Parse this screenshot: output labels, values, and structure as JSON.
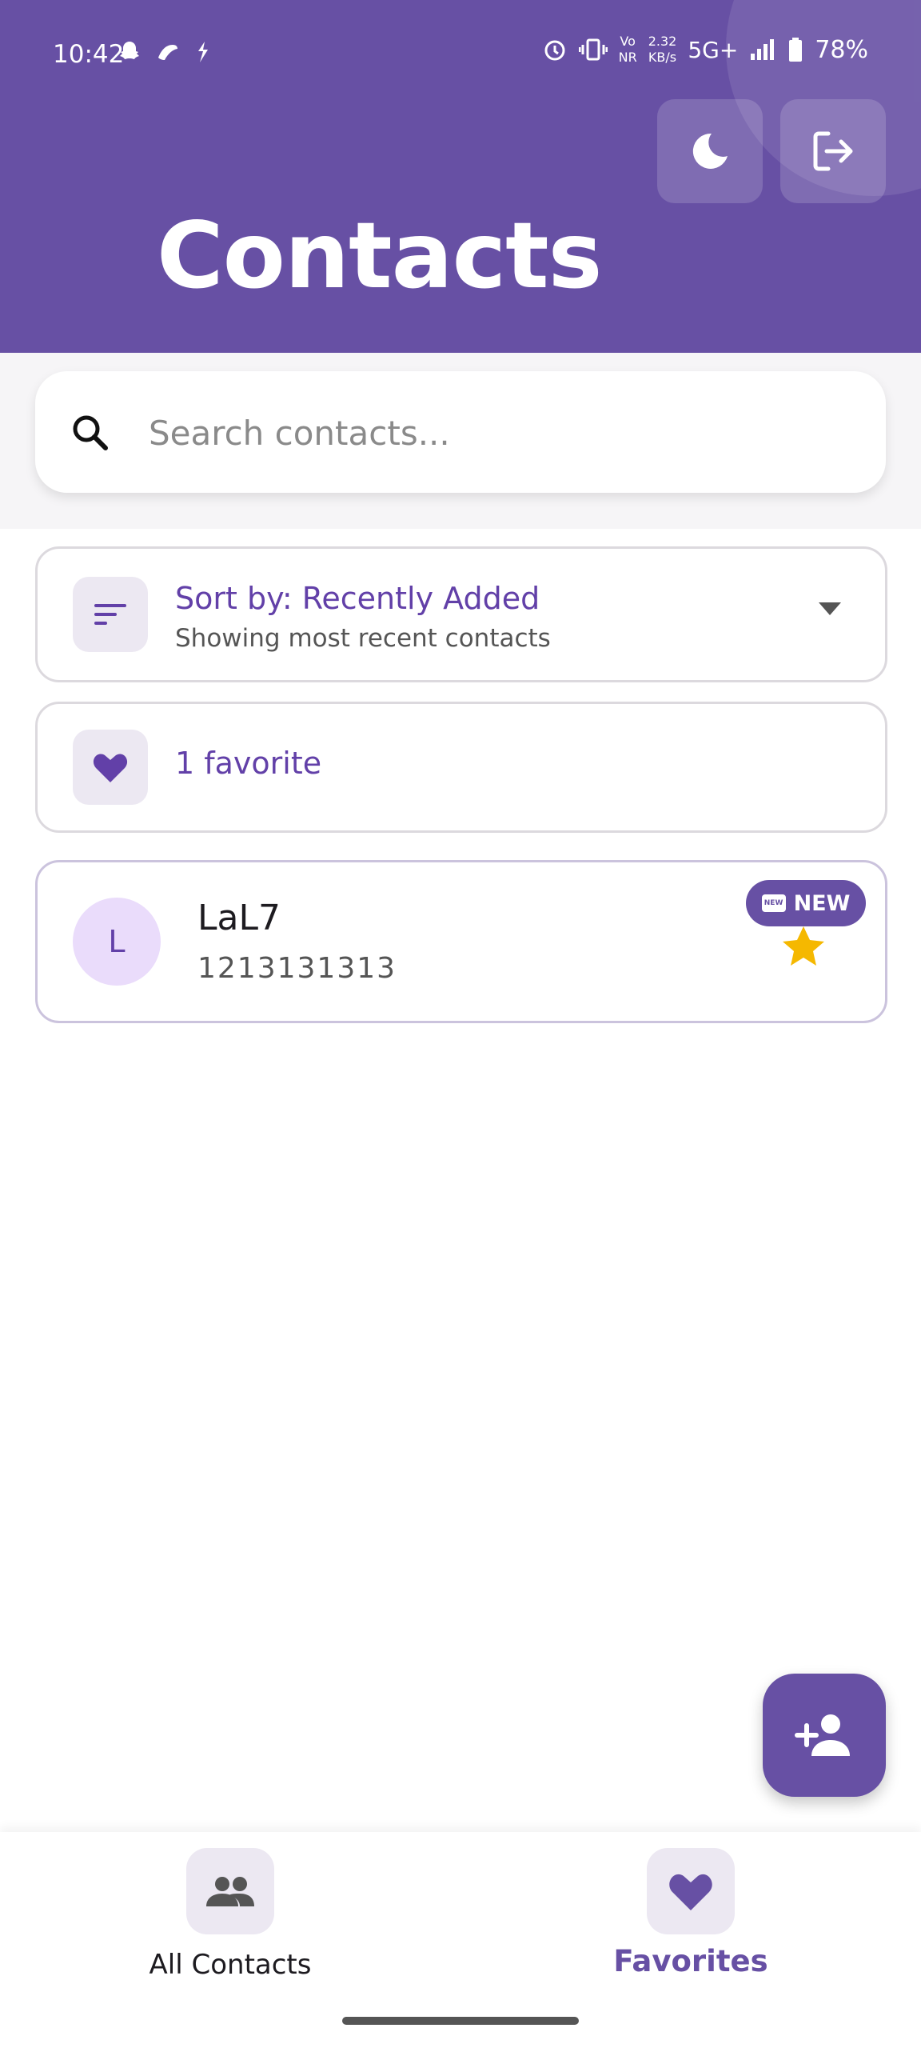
{
  "status_bar": {
    "time": "10:42",
    "speed_value": "2.32",
    "speed_unit": "KB/s",
    "vo_top": "Vo",
    "vo_bottom": "NR",
    "network": "5G+",
    "battery": "78%",
    "left_icons": [
      "snapchat-icon",
      "app-icon",
      "messenger-icon"
    ],
    "right_icons": [
      "alarm-icon",
      "vibrate-icon",
      "signal-icon",
      "battery-icon"
    ]
  },
  "header": {
    "title": "Contacts",
    "background_color": "#6750a4",
    "actions": [
      "dark-mode-moon-icon",
      "logout-icon"
    ]
  },
  "search": {
    "placeholder": "Search contacts..."
  },
  "sort": {
    "title": "Sort by: Recently Added",
    "subtitle": "Showing most recent contacts"
  },
  "favorites_summary": {
    "text": "1 favorite"
  },
  "contacts": [
    {
      "initial": "L",
      "name": "LaL7",
      "phone": "1213131313",
      "badge": "NEW",
      "badge_icon_text": "NEW",
      "favorite": true
    }
  ],
  "fab": {
    "icon": "add-person-icon"
  },
  "bottom_nav": {
    "items": [
      {
        "label": "All Contacts",
        "icon": "people-icon",
        "active": false
      },
      {
        "label": "Favorites",
        "icon": "heart-icon",
        "active": true
      }
    ]
  },
  "colors": {
    "primary": "#6750a4",
    "accent_text": "#6240a8",
    "star": "#f5b800",
    "avatar_bg": "#eadcfb"
  }
}
